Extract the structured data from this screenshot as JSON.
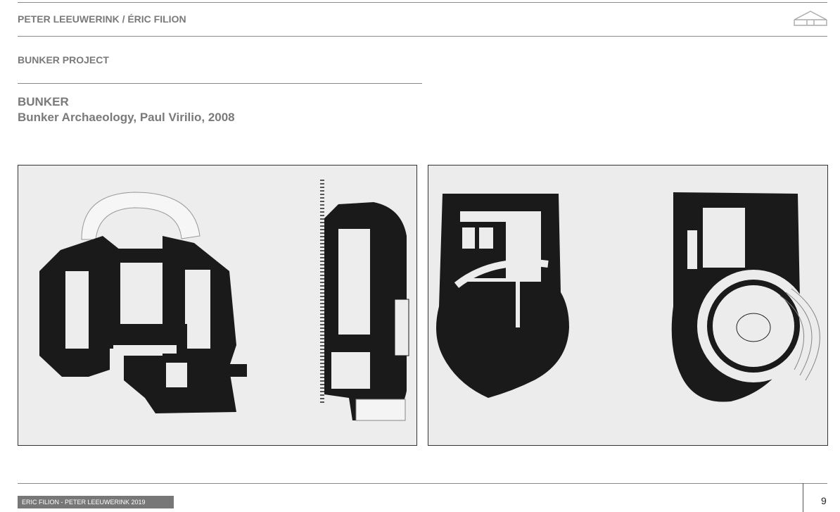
{
  "header": {
    "authors": "PETER  LEEUWERINK  / ÉRIC FILION",
    "logo_icon": "house-outline-icon"
  },
  "section": {
    "project": "BUNKER PROJECT",
    "title": "BUNKER",
    "subtitle": "Bunker Archaeology, Paul Virilio, 2008"
  },
  "images": [
    {
      "name": "bunker-plans-left",
      "icon": "floor-plan-drawing"
    },
    {
      "name": "bunker-plans-right",
      "icon": "floor-plan-drawing"
    }
  ],
  "footer": {
    "credit": "ERIC FILION - PETER  LEEUWERINK 2019",
    "page_number": "9"
  }
}
